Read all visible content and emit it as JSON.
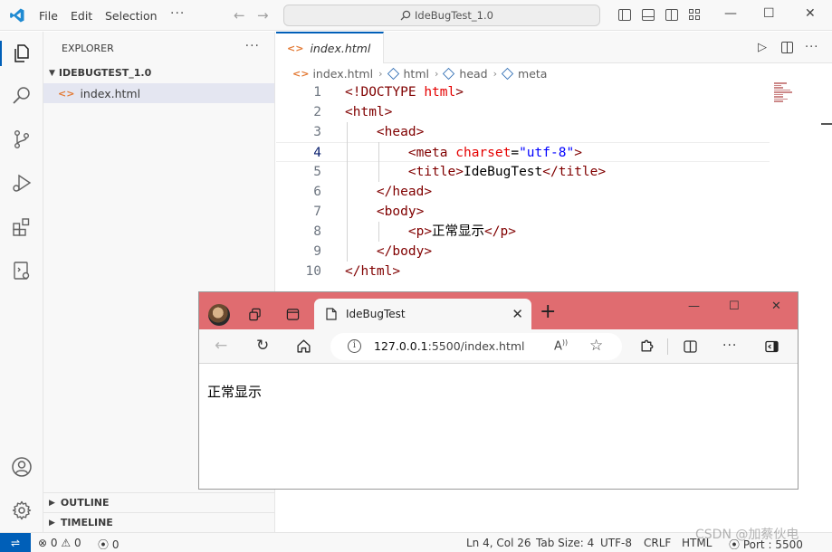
{
  "titlebar": {
    "menus": [
      "File",
      "Edit",
      "Selection"
    ],
    "more": "···",
    "command_center": "IdeBugTest_1.0"
  },
  "sidebar": {
    "title": "EXPLORER",
    "more": "···",
    "folder": "IDEBUGTEST_1.0",
    "files": [
      {
        "name": "index.html",
        "icon": "html-file-icon"
      }
    ],
    "panels": [
      "OUTLINE",
      "TIMELINE"
    ]
  },
  "editor": {
    "tab_label": "index.html",
    "breadcrumb": [
      "index.html",
      "html",
      "head",
      "meta"
    ],
    "cursor_line": 4,
    "lines": [
      {
        "num": "1",
        "code": "<!DOCTYPE html>"
      },
      {
        "num": "2",
        "code": "<html>"
      },
      {
        "num": "3",
        "code": "    <head>"
      },
      {
        "num": "4",
        "code": "        <meta charset=\"utf-8\">"
      },
      {
        "num": "5",
        "code": "        <title>IdeBugTest</title>"
      },
      {
        "num": "6",
        "code": "    </head>"
      },
      {
        "num": "7",
        "code": "    <body>"
      },
      {
        "num": "8",
        "code": "        <p>正常显示</p>"
      },
      {
        "num": "9",
        "code": "    </body>"
      },
      {
        "num": "10",
        "code": "</html>"
      }
    ]
  },
  "statusbar": {
    "errors": "0",
    "warnings": "0",
    "ports": "0",
    "position": "Ln 4, Col 26",
    "tab_size": "Tab Size: 4",
    "encoding": "UTF-8",
    "eol": "CRLF",
    "language": "HTML",
    "port": "Port : 5500"
  },
  "watermark": "CSDN @加蔡伙电",
  "browser": {
    "tab_title": "IdeBugTest",
    "url_host": "127.0.0.1",
    "url_rest": ":5500/index.html",
    "page_text": "正常显示"
  },
  "colors": {
    "accent": "#005fb8",
    "browser_titlebar": "#e06c70",
    "code_tag": "#800000",
    "code_attr": "#e50000",
    "code_string": "#0000ff"
  }
}
